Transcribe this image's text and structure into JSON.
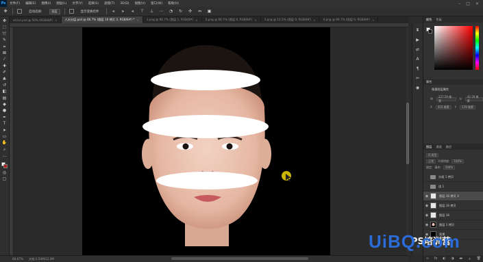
{
  "menubar": {
    "logo": "Ps",
    "items": [
      "文件(F)",
      "编辑(E)",
      "图像(I)",
      "图层(L)",
      "文字(Y)",
      "选择(S)",
      "滤镜(T)",
      "3D(D)",
      "视图(V)",
      "窗口(W)",
      "帮助(H)"
    ]
  },
  "optbar": {
    "auto_select_label": "自动选择:",
    "auto_select_value": "图层",
    "transform_label": "显示变换控件"
  },
  "tabs": [
    {
      "label": "sd.tur.psd @ 50% (RGB/8#)"
    },
    {
      "label": "人头分层.psd @ 66.7% (图层 16 拷贝 3, RGB/8#) *"
    },
    {
      "label": "1.png @ 66.7% (图层 1, RGB/8#)"
    },
    {
      "label": "2.png @ 66.7% (图层 0, RGB/8#)"
    },
    {
      "label": "3.png @ 12.5% (图层 0, RGB/8#)"
    },
    {
      "label": "4.png @ 66.7% (图层 0, RGB/8#)"
    }
  ],
  "status": {
    "zoom": "66.67%",
    "doc": "文档:1.54M/12.0M"
  },
  "right": {
    "color_tabs": [
      "颜色",
      "色板"
    ],
    "properties_tab": "属性",
    "properties_title": "像素图层属性",
    "w_label": "W",
    "w_value": "227.59 像素",
    "h_label": "H",
    "h_value": "42.78 像素",
    "x_label": "X",
    "x_value": "455 像素",
    "y_label": "Y",
    "y_value": "178 像素",
    "layers_tabs": [
      "图层",
      "通道",
      "路径"
    ],
    "kind_label": "Q 类型",
    "blend_mode": "正常",
    "opacity_label": "不透明度:",
    "opacity_value": "100%",
    "lock_label": "锁定:",
    "fill_label": "填充:",
    "fill_value": "100%"
  },
  "layers": [
    {
      "name": "分组 1 拷贝",
      "kind": "folder",
      "visible": true,
      "selected": false
    },
    {
      "name": "组 1",
      "kind": "folder",
      "visible": true,
      "selected": false
    },
    {
      "name": "图层 16 拷贝 3",
      "kind": "white",
      "visible": true,
      "selected": true
    },
    {
      "name": "图层 16 拷贝",
      "kind": "white",
      "visible": true,
      "selected": false
    },
    {
      "name": "图层 16",
      "kind": "white",
      "visible": true,
      "selected": false
    },
    {
      "name": "图层 1 拷贝",
      "kind": "face",
      "visible": true,
      "selected": false
    },
    {
      "name": "背景",
      "kind": "black",
      "visible": true,
      "selected": false
    }
  ],
  "watermark": {
    "main_u": "U",
    "main_i": "i",
    "main_rest": "BQ.com",
    "small": "PS培训营"
  }
}
